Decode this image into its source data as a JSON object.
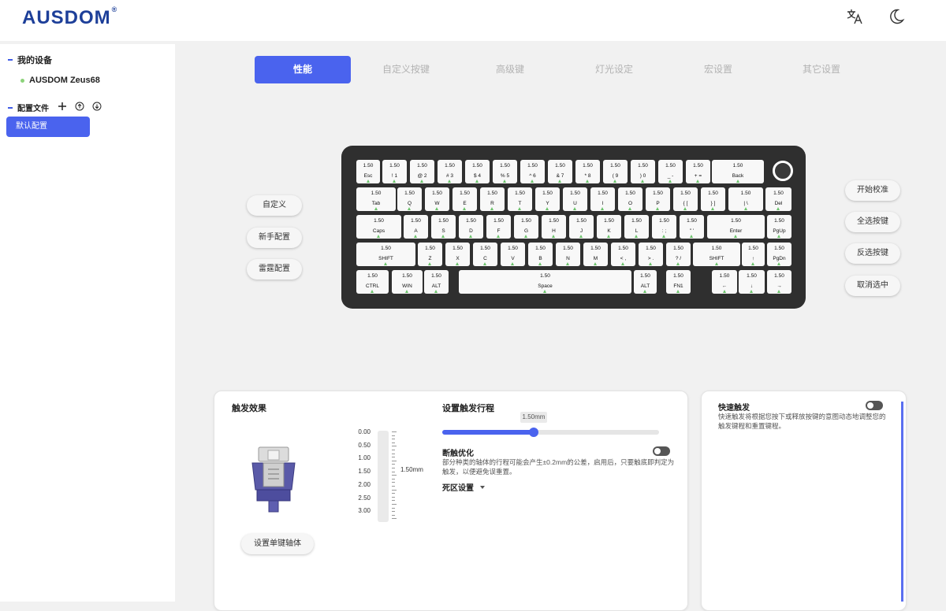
{
  "app": {
    "logo": "AUSDOM",
    "logo_mark": "®"
  },
  "sidebar": {
    "devices_heading": "我的设备",
    "device_name": "AUSDOM Zeus68",
    "profiles_heading": "配置文件",
    "active_profile": "默认配置"
  },
  "tabs": [
    {
      "label": "性能",
      "active": true
    },
    {
      "label": "自定义按键",
      "active": false
    },
    {
      "label": "高级键",
      "active": false
    },
    {
      "label": "灯光设定",
      "active": false
    },
    {
      "label": "宏设置",
      "active": false
    },
    {
      "label": "其它设置",
      "active": false
    }
  ],
  "left_buttons": [
    "自定义",
    "新手配置",
    "雷霆配置"
  ],
  "right_buttons": [
    "开始校准",
    "全选按键",
    "反选按键",
    "取消选中"
  ],
  "keyboard": {
    "rows": [
      {
        "keys": [
          {
            "label": "Esc",
            "value": "1.50"
          },
          {
            "label": "! 1",
            "value": "1.50"
          },
          {
            "label": "@ 2",
            "value": "1.50"
          },
          {
            "label": "# 3",
            "value": "1.50"
          },
          {
            "label": "$ 4",
            "value": "1.50"
          },
          {
            "label": "% 5",
            "value": "1.50"
          },
          {
            "label": "^ 6",
            "value": "1.50"
          },
          {
            "label": "& 7",
            "value": "1.50"
          },
          {
            "label": "* 8",
            "value": "1.50"
          },
          {
            "label": "( 9",
            "value": "1.50"
          },
          {
            "label": ") 0",
            "value": "1.50"
          },
          {
            "label": "_ -",
            "value": "1.50"
          },
          {
            "label": "+ =",
            "value": "1.50"
          },
          {
            "label": "Back",
            "value": "1.50"
          }
        ]
      },
      {
        "keys": [
          {
            "label": "Tab",
            "value": "1.50"
          },
          {
            "label": "Q",
            "value": "1.50"
          },
          {
            "label": "W",
            "value": "1.50"
          },
          {
            "label": "E",
            "value": "1.50"
          },
          {
            "label": "R",
            "value": "1.50"
          },
          {
            "label": "T",
            "value": "1.50"
          },
          {
            "label": "Y",
            "value": "1.50"
          },
          {
            "label": "U",
            "value": "1.50"
          },
          {
            "label": "I",
            "value": "1.50"
          },
          {
            "label": "O",
            "value": "1.50"
          },
          {
            "label": "P",
            "value": "1.50"
          },
          {
            "label": "{ [",
            "value": "1.50"
          },
          {
            "label": "} ]",
            "value": "1.50"
          },
          {
            "label": "| \\",
            "value": "1.50"
          },
          {
            "label": "Del",
            "value": "1.50"
          }
        ]
      },
      {
        "keys": [
          {
            "label": "Caps",
            "value": "1.50"
          },
          {
            "label": "A",
            "value": "1.50"
          },
          {
            "label": "S",
            "value": "1.50"
          },
          {
            "label": "D",
            "value": "1.50"
          },
          {
            "label": "F",
            "value": "1.50"
          },
          {
            "label": "G",
            "value": "1.50"
          },
          {
            "label": "H",
            "value": "1.50"
          },
          {
            "label": "J",
            "value": "1.50"
          },
          {
            "label": "K",
            "value": "1.50"
          },
          {
            "label": "L",
            "value": "1.50"
          },
          {
            "label": ": ;",
            "value": "1.50"
          },
          {
            "label": "\" '",
            "value": "1.50"
          },
          {
            "label": "Enter",
            "value": "1.50"
          },
          {
            "label": "PgUp",
            "value": "1.50"
          }
        ]
      },
      {
        "keys": [
          {
            "label": "SHIFT",
            "value": "1.50"
          },
          {
            "label": "Z",
            "value": "1.50"
          },
          {
            "label": "X",
            "value": "1.50"
          },
          {
            "label": "C",
            "value": "1.50"
          },
          {
            "label": "V",
            "value": "1.50"
          },
          {
            "label": "B",
            "value": "1.50"
          },
          {
            "label": "N",
            "value": "1.50"
          },
          {
            "label": "M",
            "value": "1.50"
          },
          {
            "label": "< ,",
            "value": "1.50"
          },
          {
            "label": "> .",
            "value": "1.50"
          },
          {
            "label": "? /",
            "value": "1.50"
          },
          {
            "label": "SHIFT",
            "value": "1.50"
          },
          {
            "label": "↑",
            "value": "1.50"
          },
          {
            "label": "PgDn",
            "value": "1.50"
          }
        ]
      },
      {
        "keys": [
          {
            "label": "CTRL",
            "value": "1.50"
          },
          {
            "label": "WIN",
            "value": "1.50"
          },
          {
            "label": "ALT",
            "value": "1.50"
          },
          {
            "label": "Space",
            "value": "1.50"
          },
          {
            "label": "ALT",
            "value": "1.50"
          },
          {
            "label": "FN1",
            "value": "1.50"
          },
          {
            "label": "←",
            "value": "1.50"
          },
          {
            "label": "↓",
            "value": "1.50"
          },
          {
            "label": "→",
            "value": "1.50"
          }
        ]
      }
    ]
  },
  "trigger_card": {
    "title": "触发效果",
    "scale_ticks": [
      "0.00",
      "0.50",
      "1.00",
      "1.50",
      "2.00",
      "2.50",
      "3.00"
    ],
    "current_value": "1.50mm",
    "switch_button": "设置单键轴体"
  },
  "travel": {
    "title": "设置触发行程",
    "tooltip": "1.50mm",
    "fraction": 0.42,
    "disconnect_title": "断触优化",
    "disconnect_desc_1": "部分种类的轴体的行程可能会产生±0.2mm的公差，启用后，只要触底即判定为",
    "disconnect_desc_2": "触发，以便避免误重置。",
    "disconnect_enabled": false,
    "deadzone_label": "死区设置"
  },
  "rapid": {
    "title": "快速触发",
    "desc_1": "快速触发将根据您按下或释放按键的意图动态地调整您的",
    "desc_2": "触发键程和重置键程。",
    "enabled": false
  },
  "colors": {
    "accent": "#4a63ee",
    "logo": "#1d3f99",
    "key_marker": "#6ac26a",
    "board": "#2f2f2f"
  }
}
